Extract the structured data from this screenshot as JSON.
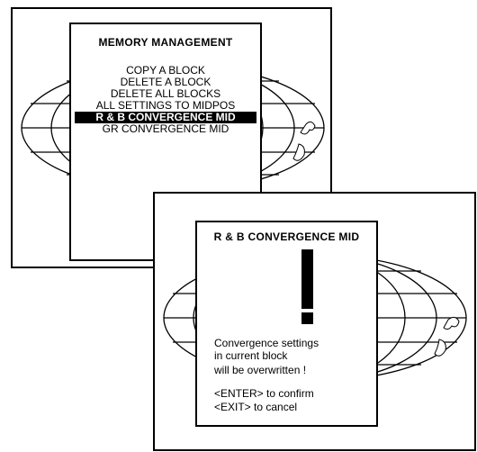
{
  "screen1": {
    "menu": {
      "title": "MEMORY MANAGEMENT",
      "items": [
        {
          "label": "COPY A BLOCK",
          "selected": false
        },
        {
          "label": "DELETE A BLOCK",
          "selected": false
        },
        {
          "label": "DELETE ALL BLOCKS",
          "selected": false
        },
        {
          "label": "ALL SETTINGS TO MIDPOS",
          "selected": false
        },
        {
          "label": "R & B CONVERGENCE MID",
          "selected": true
        },
        {
          "label": "GR CONVERGENCE MID",
          "selected": false
        }
      ]
    }
  },
  "screen2": {
    "dialog": {
      "title": "R & B CONVERGENCE MID",
      "icon": "exclamation-icon",
      "message_lines": [
        "Convergence settings",
        "in current block",
        "will be overwritten !"
      ],
      "confirm_hint": "<ENTER> to confirm",
      "cancel_hint": "<EXIT> to cancel"
    }
  }
}
